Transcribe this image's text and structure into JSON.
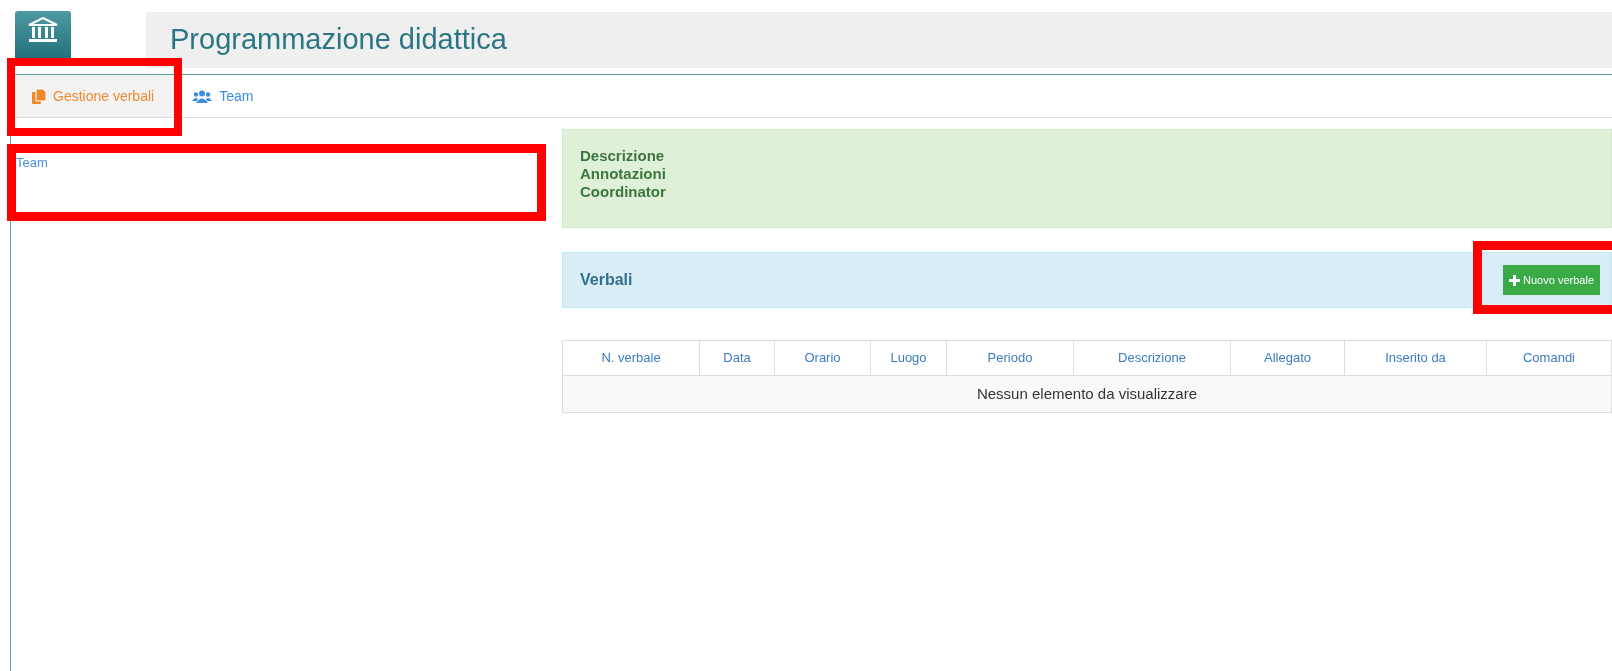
{
  "header": {
    "title": "Programmazione didattica"
  },
  "tabs": [
    {
      "label": "Gestione verbali",
      "kind": "copy",
      "selected": true,
      "highlighted": true
    },
    {
      "label": "Team",
      "kind": "users",
      "selected": false,
      "highlighted": false
    }
  ],
  "sidebar": {
    "items": [
      {
        "label": "Team",
        "highlighted": true
      }
    ]
  },
  "info_panel": {
    "lines": [
      "Descrizione",
      "Annotazioni",
      "Coordinator"
    ]
  },
  "verbali_panel": {
    "title": "Verbali",
    "button": {
      "label": "Nuovo verbale",
      "highlighted": true
    }
  },
  "table": {
    "columns": [
      "N. verbale",
      "Data",
      "Orario",
      "Luogo",
      "Periodo",
      "Descrizione",
      "Allegato",
      "Inserito da",
      "Comandi"
    ],
    "empty_message": "Nessun elemento da visualizzare"
  }
}
